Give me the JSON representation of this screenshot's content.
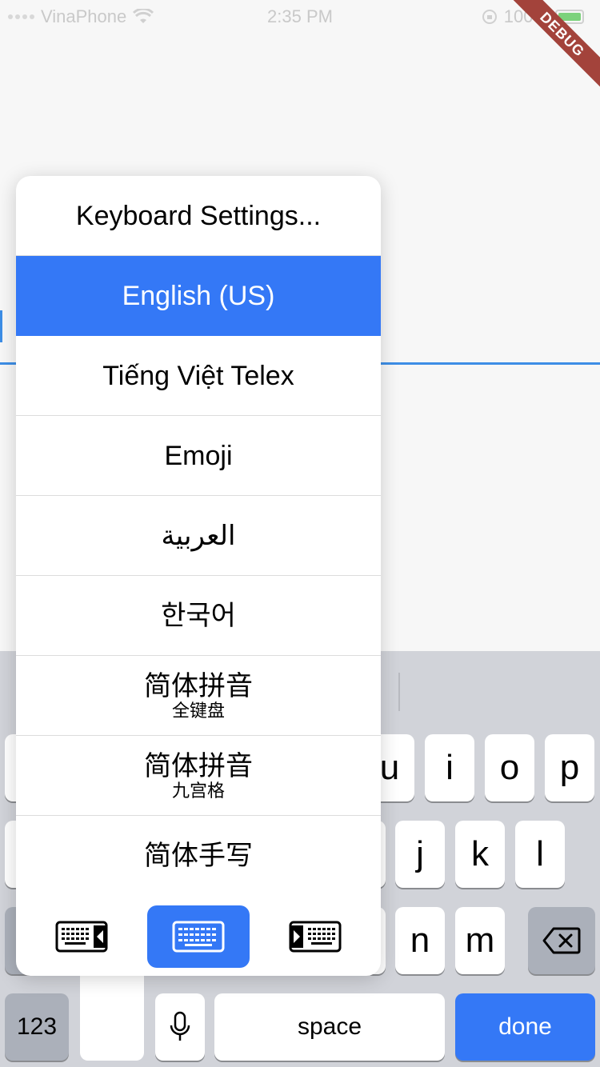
{
  "status_bar": {
    "carrier": "VinaPhone",
    "time": "2:35 PM",
    "battery": "100%",
    "debug": "DEBUG"
  },
  "keyboard_menu": {
    "items": [
      {
        "label": "Keyboard Settings...",
        "sub": ""
      },
      {
        "label": "English (US)",
        "sub": "",
        "selected": true
      },
      {
        "label": "Tiếng Việt Telex",
        "sub": ""
      },
      {
        "label": "Emoji",
        "sub": ""
      },
      {
        "label": "العربية",
        "sub": ""
      },
      {
        "label": "한국어",
        "sub": ""
      },
      {
        "label": "简体拼音",
        "sub": "全键盘"
      },
      {
        "label": "简体拼音",
        "sub": "九宫格"
      },
      {
        "label": "简体手写",
        "sub": ""
      }
    ],
    "layout_options": [
      "keyboard-left-icon",
      "keyboard-full-icon",
      "keyboard-right-icon"
    ],
    "active_layout": "keyboard-full-icon"
  },
  "keyboard": {
    "row1": [
      "u",
      "i",
      "o",
      "p"
    ],
    "row2": [
      "j",
      "k",
      "l"
    ],
    "row3": [
      "n",
      "m"
    ],
    "numbers_key": "123",
    "space_key": "space",
    "done_key": "done"
  },
  "colors": {
    "accent": "#3478f6",
    "keyboard_bg": "#d1d3d9",
    "field_line": "#3d8ee6",
    "debug_banner": "#a3433b"
  }
}
